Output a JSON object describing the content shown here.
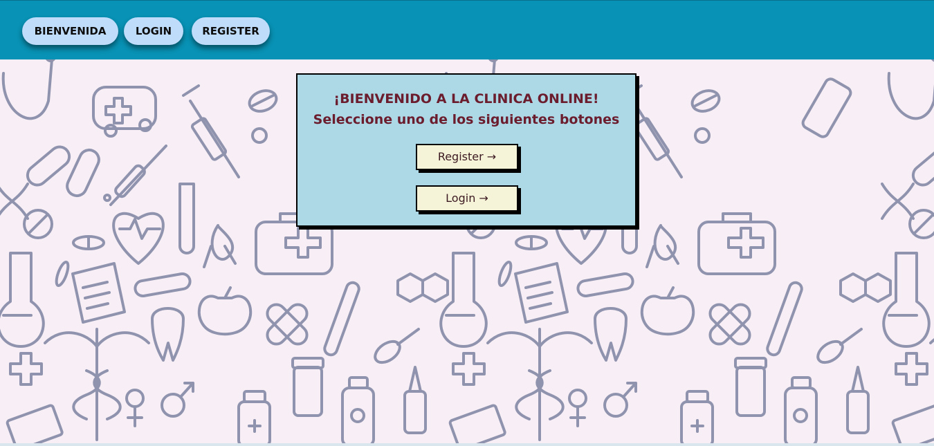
{
  "navbar": {
    "buttons": [
      {
        "label": "BIENVENIDA"
      },
      {
        "label": "LOGIN"
      },
      {
        "label": "REGISTER"
      }
    ],
    "background_color": "#0892b5",
    "button_color": "#bfdcfb"
  },
  "background": {
    "pattern": "medical doodles",
    "base_color": "#f8eef6",
    "doodle_color": "#8f93ad"
  },
  "welcome_card": {
    "title": "¡BIENVENIDO A LA CLINICA ONLINE!",
    "subtitle": "Seleccione uno de los siguientes botones",
    "register_button": "Register →",
    "login_button": "Login →",
    "card_color": "#add8e6",
    "title_color": "#6b1d2e",
    "button_color": "#f6f4d8"
  }
}
